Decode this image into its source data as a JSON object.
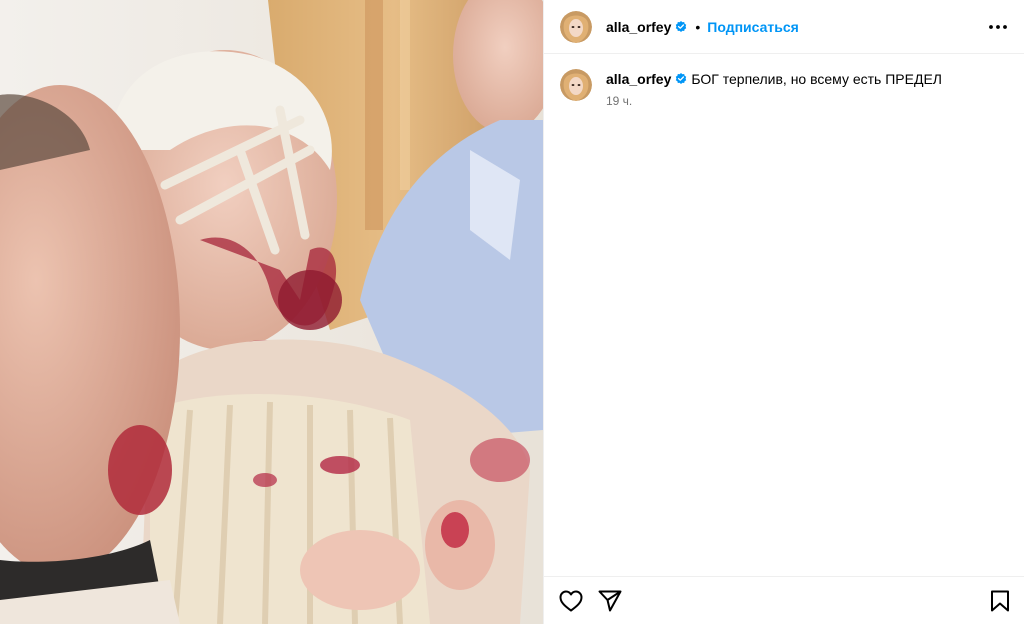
{
  "post": {
    "username": "alla_orfey",
    "follow_label": "Подписаться",
    "separator": "•",
    "caption_text": "БОГ терпелив, но всему есть ПРЕДЕЛ",
    "time": "19 ч.",
    "verified": true
  },
  "icons": {
    "more": "more-options-icon",
    "like": "heart-icon",
    "share": "send-icon",
    "save": "bookmark-icon",
    "verified": "verified-badge-icon"
  },
  "colors": {
    "link_blue": "#0095f6",
    "verified_blue": "#0095f6",
    "muted_text": "#737373",
    "divider": "#efefef"
  }
}
